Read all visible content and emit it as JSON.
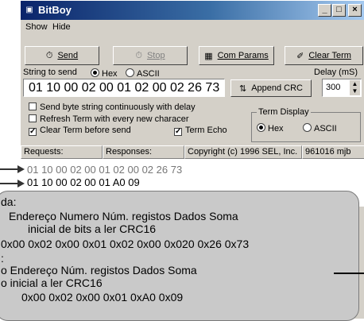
{
  "window": {
    "title": "BitBoy"
  },
  "menu": {
    "show": "Show",
    "hide": "Hide"
  },
  "buttons": {
    "send": "Send",
    "stop": "Stop",
    "com_params": "Com Params",
    "clear_term": "Clear Term",
    "append_crc": "Append CRC"
  },
  "send_area": {
    "label": "String to send",
    "radio_hex": "Hex",
    "radio_ascii": "ASCII",
    "value": "01 10 00 02 00 01 02 00 02 26 73",
    "delay_label": "Delay (mS)",
    "delay_value": "300"
  },
  "options": {
    "continuous": "Send byte string continuously with delay",
    "refresh": "Refresh Term with every new characer",
    "clear_before_send": "Clear Term before send",
    "term_echo": "Term Echo"
  },
  "term_display": {
    "title": "Term Display",
    "hex": "Hex",
    "ascii": "ASCII"
  },
  "headers": {
    "requests": "Requests:",
    "responses": "Responses:",
    "copyright": "Copyright (c) 1996 SEL, Inc.",
    "version": "961016 mjb"
  },
  "terminal": {
    "line1": "01 10 00 02 00 01 02 00 02 26 73",
    "line2": "01 10 00 02 00 01 A0 09"
  },
  "callout": {
    "line1": "da:",
    "line2": "Endereço  Numero  Núm. registos    Dados       Soma",
    "line3": "inicial      de bits          a ler                               CRC16",
    "line4": "0x00 0x02   0x00 0x01      0x02   0x00 0x020   0x26 0x73",
    "line5": ":",
    "line6": "o   Endereço   Núm. registos    Dados        Soma",
    "line7": "o    inicial            a ler                            CRC16",
    "line8": "0x00 0x02       0x00 0x01        0xA0 0x09"
  }
}
